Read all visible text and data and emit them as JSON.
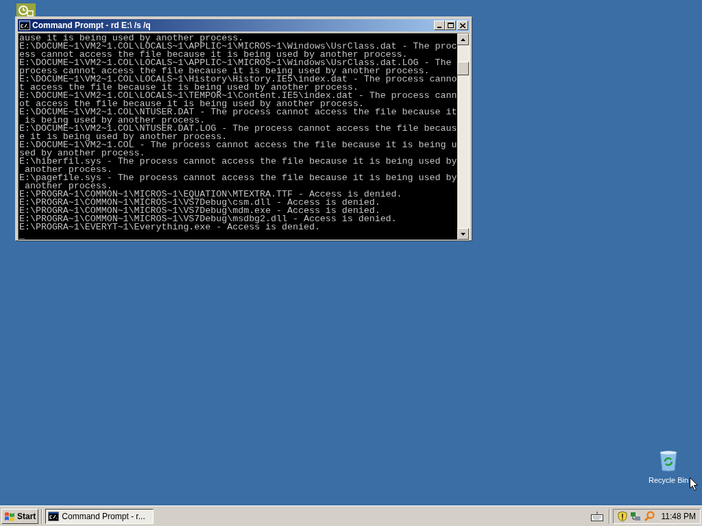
{
  "desktop_icons": [
    {
      "kind": "shortcut"
    },
    {
      "kind": "recycle_bin",
      "label_lines": [
        "Recycle Bin"
      ]
    }
  ],
  "window": {
    "title": "Command Prompt - rd E:\\ /s /q",
    "lines": [
      "ause it is being used by another process.",
      "E:\\DOCUME~1\\VM2~1.COL\\LOCALS~1\\APPLIC~1\\MICROS~1\\Windows\\UsrClass.dat - The proc",
      "ess cannot access the file because it is being used by another process.",
      "E:\\DOCUME~1\\VM2~1.COL\\LOCALS~1\\APPLIC~1\\MICROS~1\\Windows\\UsrClass.dat.LOG - The",
      "process cannot access the file because it is being used by another process.",
      "E:\\DOCUME~1\\VM2~1.COL\\LOCALS~1\\History\\History.IE5\\index.dat - The process canno",
      "t access the file because it is being used by another process.",
      "E:\\DOCUME~1\\VM2~1.COL\\LOCALS~1\\TEMPOR~1\\Content.IE5\\index.dat - The process cann",
      "ot access the file because it is being used by another process.",
      "E:\\DOCUME~1\\VM2~1.COL\\NTUSER.DAT - The process cannot access the file because it",
      " is being used by another process.",
      "E:\\DOCUME~1\\VM2~1.COL\\NTUSER.DAT.LOG - The process cannot access the file becaus",
      "e it is being used by another process.",
      "E:\\DOCUME~1\\VM2~1.COL - The process cannot access the file because it is being u",
      "sed by another process.",
      "E:\\hiberfil.sys - The process cannot access the file because it is being used by",
      " another process.",
      "E:\\pagefile.sys - The process cannot access the file because it is being used by",
      " another process.",
      "E:\\PROGRA~1\\COMMON~1\\MICROS~1\\EQUATION\\MTEXTRA.TTF - Access is denied.",
      "E:\\PROGRA~1\\COMMON~1\\MICROS~1\\VS7Debug\\csm.dll - Access is denied.",
      "E:\\PROGRA~1\\COMMON~1\\MICROS~1\\VS7Debug\\mdm.exe - Access is denied.",
      "E:\\PROGRA~1\\COMMON~1\\MICROS~1\\VS7Debug\\msdbg2.dll - Access is denied.",
      "E:\\PROGRA~1\\EVERYT~1\\Everything.exe - Access is denied."
    ],
    "cursor": "_"
  },
  "taskbar": {
    "start": "Start",
    "tasks": [
      {
        "label": "Command Prompt - r...",
        "selected": true
      }
    ],
    "clock": "11:48 PM"
  }
}
